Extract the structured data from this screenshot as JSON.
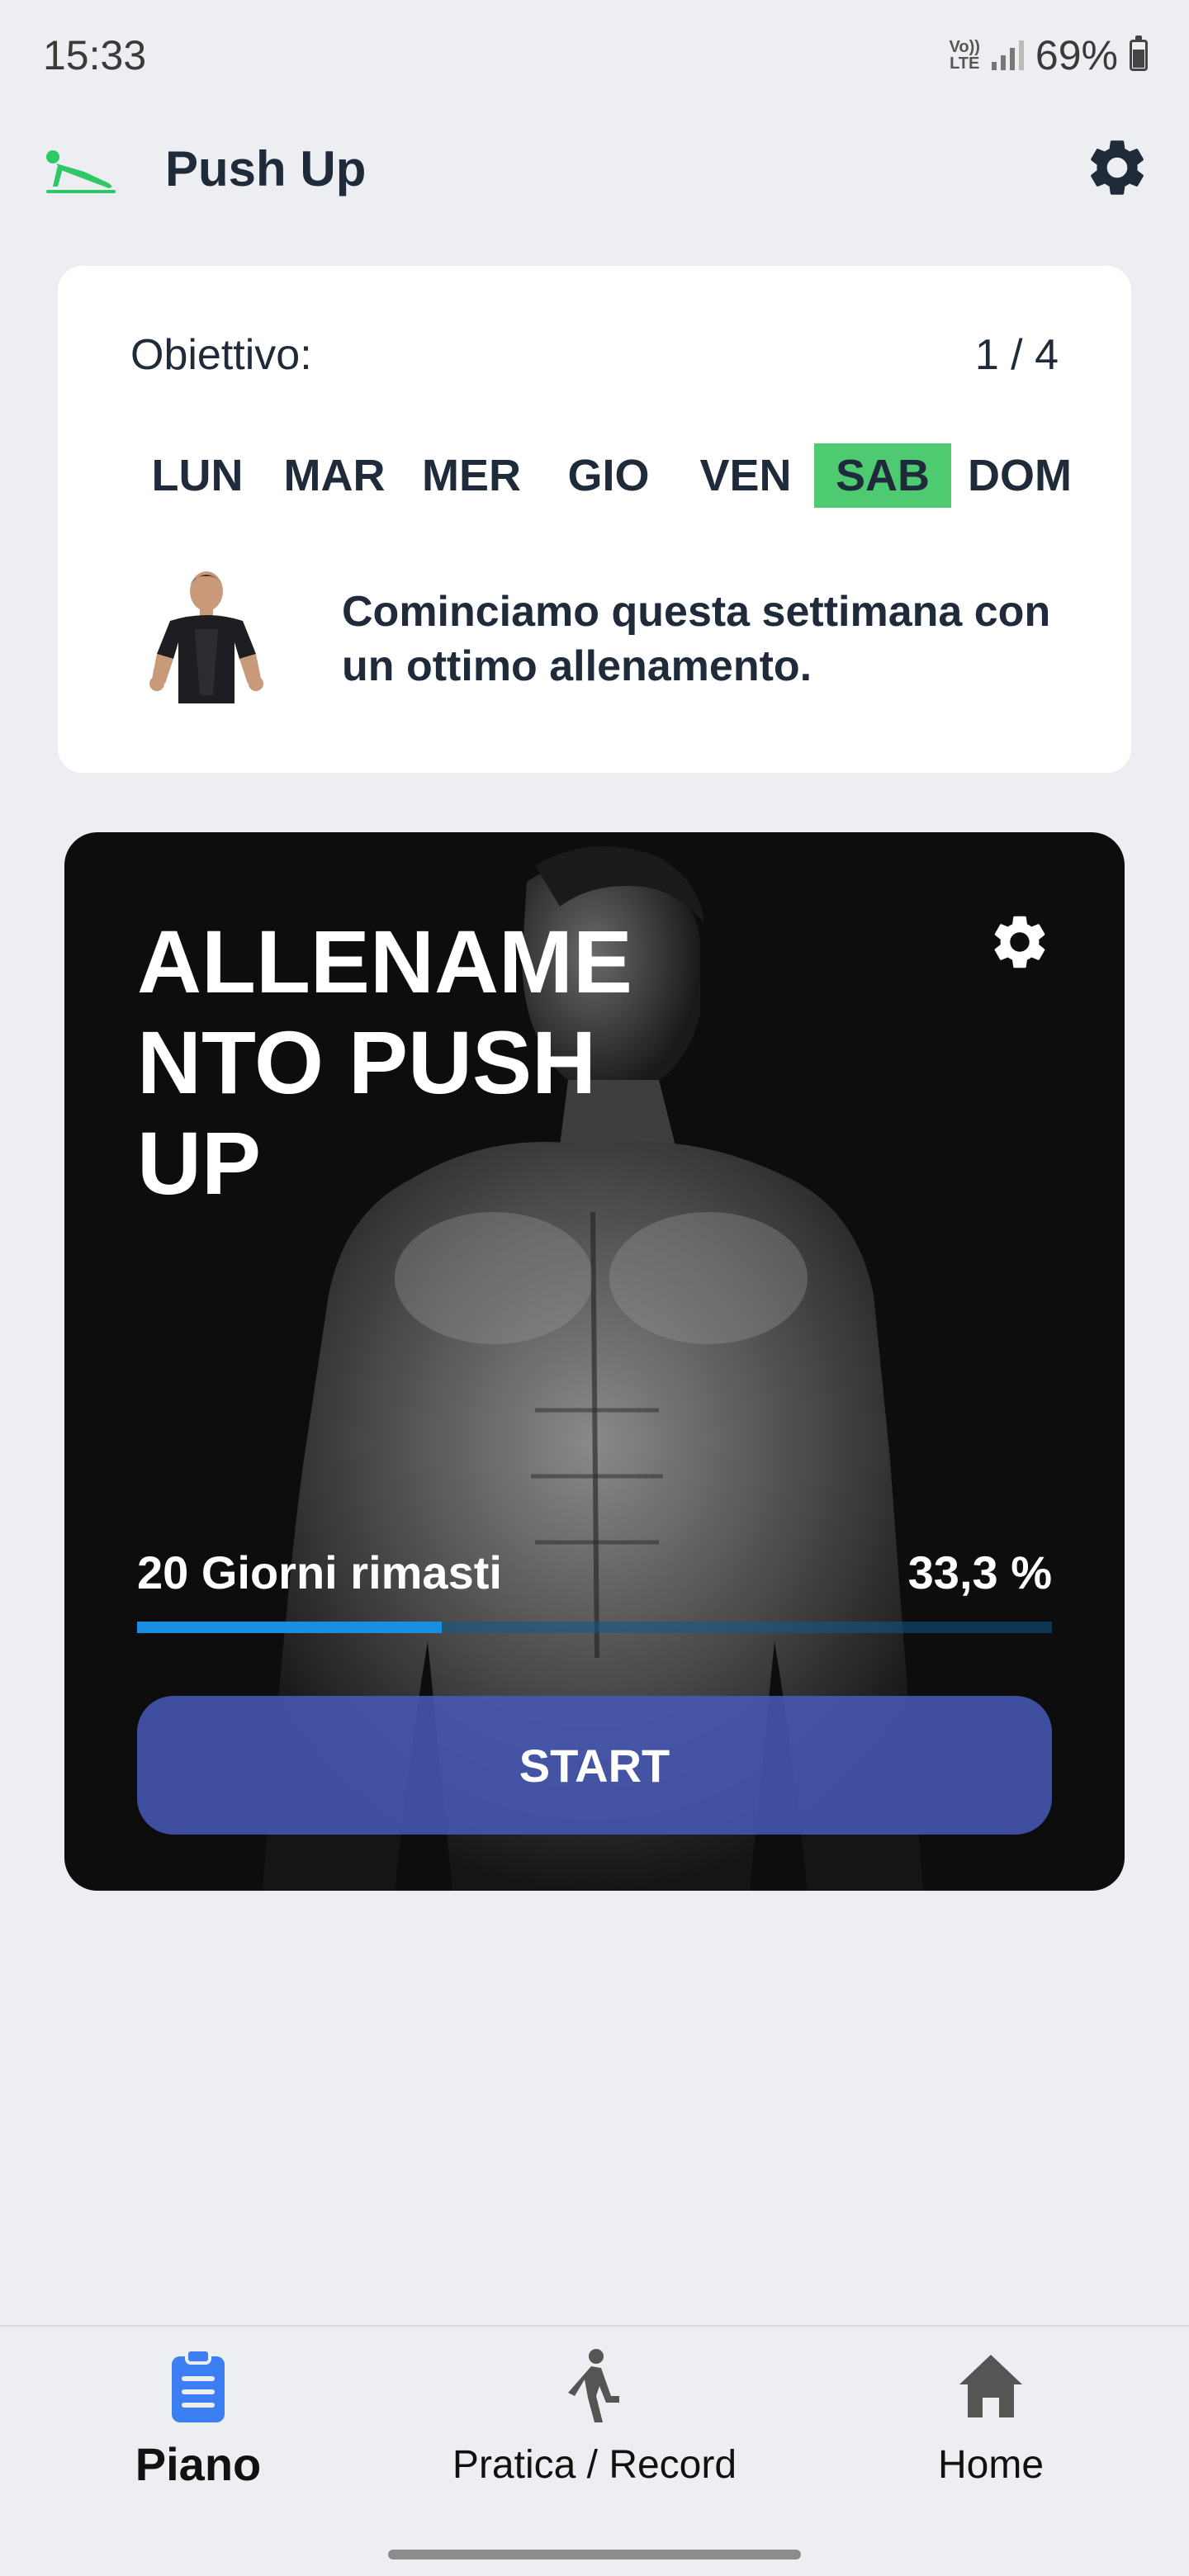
{
  "status_bar": {
    "time": "15:33",
    "network_label_top": "Vo))",
    "network_label_bottom": "LTE",
    "battery": "69%",
    "battery_level": 0.69
  },
  "header": {
    "title": "Push Up",
    "logo_icon": "pushup-logo-icon",
    "settings_icon": "gear-icon"
  },
  "goal_card": {
    "label": "Obiettivo:",
    "count": "1 / 4",
    "weekdays": [
      "LUN",
      "MAR",
      "MER",
      "GIO",
      "VEN",
      "SAB",
      "DOM"
    ],
    "active_day": "SAB",
    "active_color": "#4ecb71",
    "message": "Cominciamo questa settimana con un ottimo allenamento."
  },
  "workout_card": {
    "title": "ALLENAMENTO PUSH UP",
    "days_left": "20 Giorni rimasti",
    "progress_label": "33,3 %",
    "progress": 0.333,
    "start_label": "START",
    "accent_color": "#1a8fe0",
    "button_color": "#4858b4"
  },
  "bottom_nav": {
    "items": [
      {
        "label": "Piano",
        "icon": "clipboard-icon",
        "active": true
      },
      {
        "label": "Pratica / Record",
        "icon": "stretching-figure-icon",
        "active": false
      },
      {
        "label": "Home",
        "icon": "home-icon",
        "active": false
      }
    ],
    "active_color": "#3b7ff2"
  }
}
